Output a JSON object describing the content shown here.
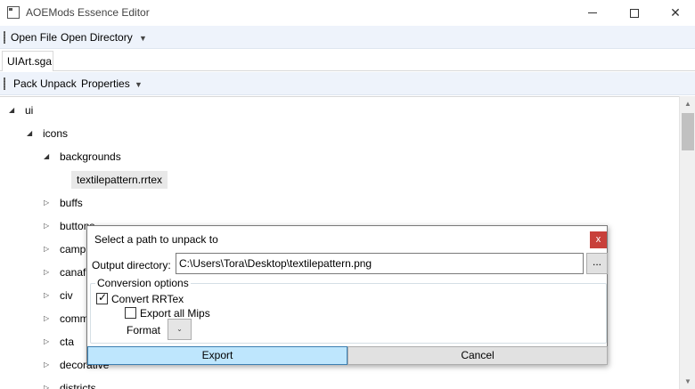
{
  "window": {
    "title": "AOEMods Essence Editor"
  },
  "main_toolbar": {
    "open_file": "Open File",
    "open_directory": "Open Directory"
  },
  "tabs": [
    {
      "label": "UIArt.sga"
    }
  ],
  "archive_toolbar": {
    "pack": "Pack",
    "unpack": "Unpack",
    "properties": "Properties"
  },
  "tree": {
    "nodes": [
      {
        "label": "ui",
        "expanded": true
      },
      {
        "label": "icons",
        "expanded": true
      },
      {
        "label": "backgrounds",
        "expanded": true
      },
      {
        "label": "textilepattern.rrtex",
        "selected": true
      },
      {
        "label": "buffs",
        "expanded": false
      },
      {
        "label": "buttons",
        "expanded": false
      },
      {
        "label": "camp",
        "expanded": false
      },
      {
        "label": "canaf",
        "expanded": false
      },
      {
        "label": "civ",
        "expanded": false
      },
      {
        "label": "comm",
        "expanded": false
      },
      {
        "label": "cta",
        "expanded": false
      },
      {
        "label": "decorative",
        "expanded": false
      },
      {
        "label": "districts",
        "expanded": false
      }
    ]
  },
  "dialog": {
    "title": "Select a path to unpack to",
    "close_glyph": "x",
    "output_label": "Output directory:",
    "output_value": "C:\\Users\\Tora\\Desktop\\textilepattern.png",
    "browse_label": "...",
    "options_group": "Conversion options",
    "convert_rrtex": {
      "label": "Convert RRTex",
      "checked": true
    },
    "export_all_mips": {
      "label": "Export all Mips",
      "checked": false
    },
    "format_label": "Format",
    "format_value": "",
    "export_button": "Export",
    "cancel_button": "Cancel"
  }
}
